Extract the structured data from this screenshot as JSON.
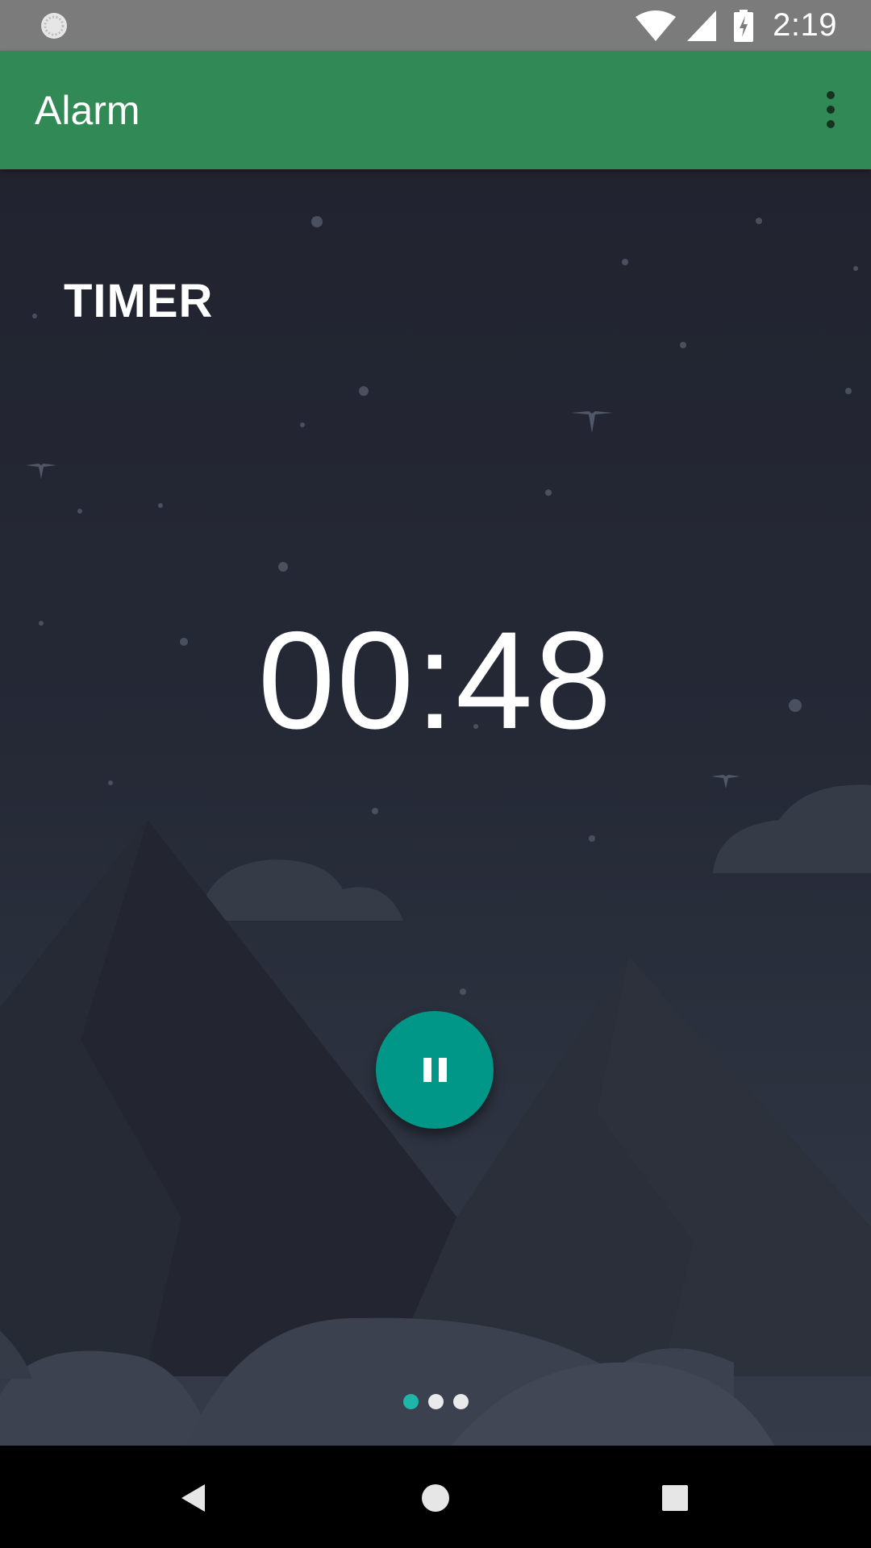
{
  "status_bar": {
    "time": "2:19",
    "left_icon": "sync-loading-icon",
    "icons": [
      "wifi-icon",
      "cell-signal-icon",
      "battery-charging-icon"
    ]
  },
  "app_bar": {
    "title": "Alarm",
    "overflow_icon": "more-vert-icon",
    "color": "#318a55"
  },
  "main": {
    "mode_title": "TIMER",
    "remaining_time": "00:48",
    "pause_button": {
      "icon": "pause-icon",
      "color": "#009688"
    },
    "page_indicator": {
      "pages": 3,
      "active_index": 0,
      "active_color": "#1fb5a9"
    }
  },
  "nav_bar": {
    "buttons": [
      "back-icon",
      "home-icon",
      "recents-icon"
    ]
  }
}
